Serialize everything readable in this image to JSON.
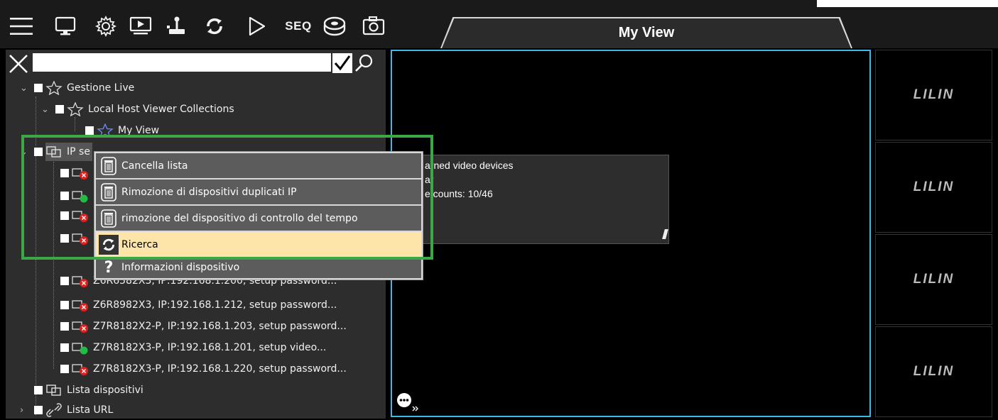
{
  "toolbar": {
    "icons": [
      "menu-icon",
      "monitor-icon",
      "gear-icon",
      "playback-icon",
      "joystick-icon",
      "refresh-icon",
      "play-icon",
      "seq-icon",
      "disk-icon",
      "camera-icon"
    ],
    "seq_label": "SEQ"
  },
  "view_tab": {
    "title": "My View"
  },
  "search": {
    "value": "",
    "placeholder": ""
  },
  "tree": {
    "gestione_live": "Gestione Live",
    "local_host": "Local Host Viewer Collections",
    "my_view": "My View",
    "ip_server": "IP se",
    "devices": [
      {
        "label": "Z6R6582X3, IP:192.168.1.200, setup password...",
        "status": "error"
      },
      {
        "label": "Z6R8982X3, IP:192.168.1.212, setup password...",
        "status": "error"
      },
      {
        "label": "Z7R8182X2-P, IP:192.168.1.203, setup password...",
        "status": "error"
      },
      {
        "label": "Z7R8182X3-P, IP:192.168.1.201, setup video...",
        "status": "ok"
      },
      {
        "label": "Z7R8182X3-P, IP:192.168.1.220, setup password...",
        "status": "error"
      }
    ],
    "lista_dispositivi": "Lista dispositivi",
    "lista_url": "Lista URL"
  },
  "context_menu": {
    "items": [
      {
        "label": "Cancella lista",
        "icon": "trash-icon"
      },
      {
        "label": "Rimozione di dispositivi duplicati IP",
        "icon": "trash-icon"
      },
      {
        "label": "rimozione del dispositivo di controllo del tempo",
        "icon": "trash-icon"
      },
      {
        "label": "Ricerca",
        "icon": "refresh-icon"
      },
      {
        "label": "Informazioni dispositivo",
        "icon": "question-icon"
      }
    ]
  },
  "info_box": {
    "line1": "arned video devices",
    "line2": "ar",
    "line3": "e counts: 10/46"
  },
  "side_cells": [
    "LILIN",
    "LILIN",
    "LILIN",
    "LILIN"
  ],
  "colors": {
    "accent_border": "#3fb8e8",
    "highlight_green": "#3aa844",
    "menu_highlight": "#fde4a8",
    "status_ok": "#22bb44",
    "status_error": "#e02020"
  }
}
